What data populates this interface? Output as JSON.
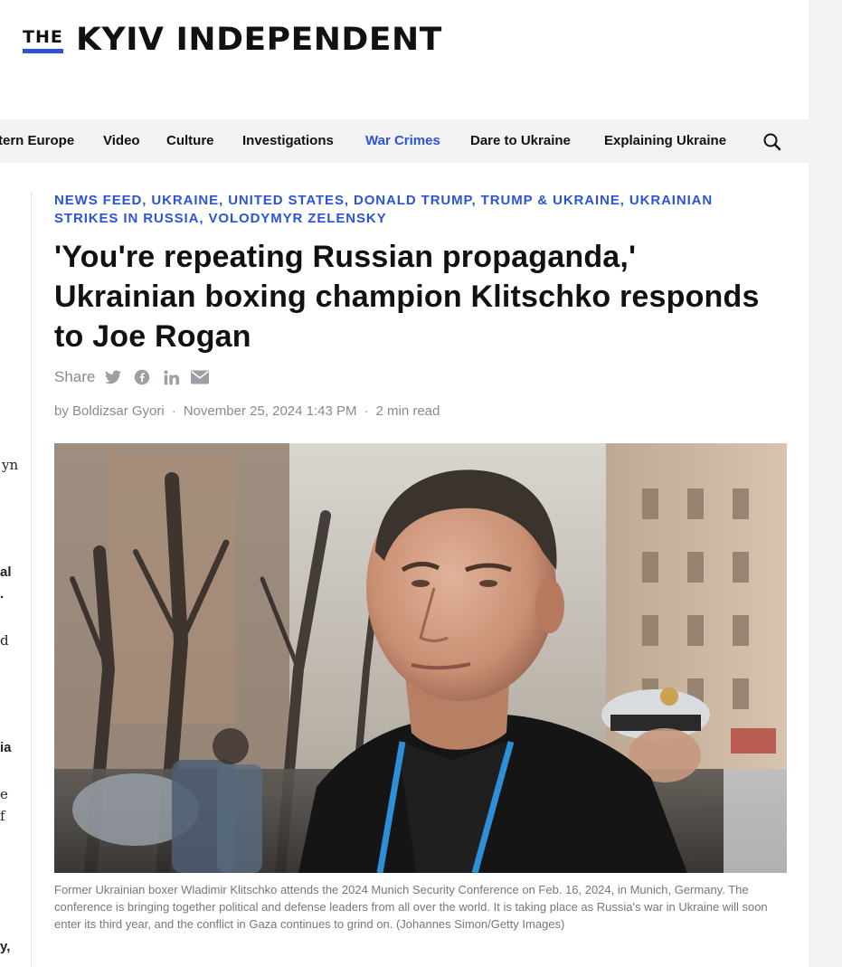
{
  "header": {
    "logo_the": "THE",
    "logo_name": "KYIV INDEPENDENT"
  },
  "nav": {
    "items": [
      {
        "label": "tern Europe"
      },
      {
        "label": "Video"
      },
      {
        "label": "Culture"
      },
      {
        "label": "Investigations"
      },
      {
        "label": "War Crimes",
        "active": true
      },
      {
        "label": "Dare to Ukraine"
      },
      {
        "label": "Explaining Ukraine"
      }
    ],
    "search_icon": "search-icon",
    "active_color": "#2b55d6"
  },
  "left_rail": {
    "fragments": [
      "yn",
      "al",
      ".",
      "d",
      "ia",
      "e",
      "f",
      "y,"
    ]
  },
  "article": {
    "tags": [
      "NEWS FEED",
      "UKRAINE",
      "UNITED STATES",
      "DONALD TRUMP",
      "TRUMP & UKRAINE",
      "UKRAINIAN STRIKES IN RUSSIA",
      "VOLODYMYR ZELENSKY"
    ],
    "headline": "'You're repeating Russian propaganda,' Ukrainian boxing champion Klitschko responds to Joe Rogan",
    "share": {
      "label": "Share",
      "icons": [
        "twitter-icon",
        "facebook-icon",
        "linkedin-icon",
        "email-icon"
      ]
    },
    "byline": {
      "author": "by Boldizsar Gyori",
      "date": "November 25, 2024 1:43 PM",
      "read_time": "2 min read"
    },
    "photo_caption": "Former Ukrainian boxer Wladimir Klitschko attends the 2024 Munich Security Conference on Feb. 16, 2024, in Munich, Germany. The conference is bringing together political and defense leaders from all over the world. It is taking place as Russia's war in Ukraine will soon enter its third year, and the conflict in Gaza continues to grind on. (Johannes Simon/Getty Images)"
  },
  "colors": {
    "accent": "#2b55d6",
    "text": "#111111",
    "muted": "#8a8a8a",
    "nav_bg": "#f2f2f2"
  }
}
